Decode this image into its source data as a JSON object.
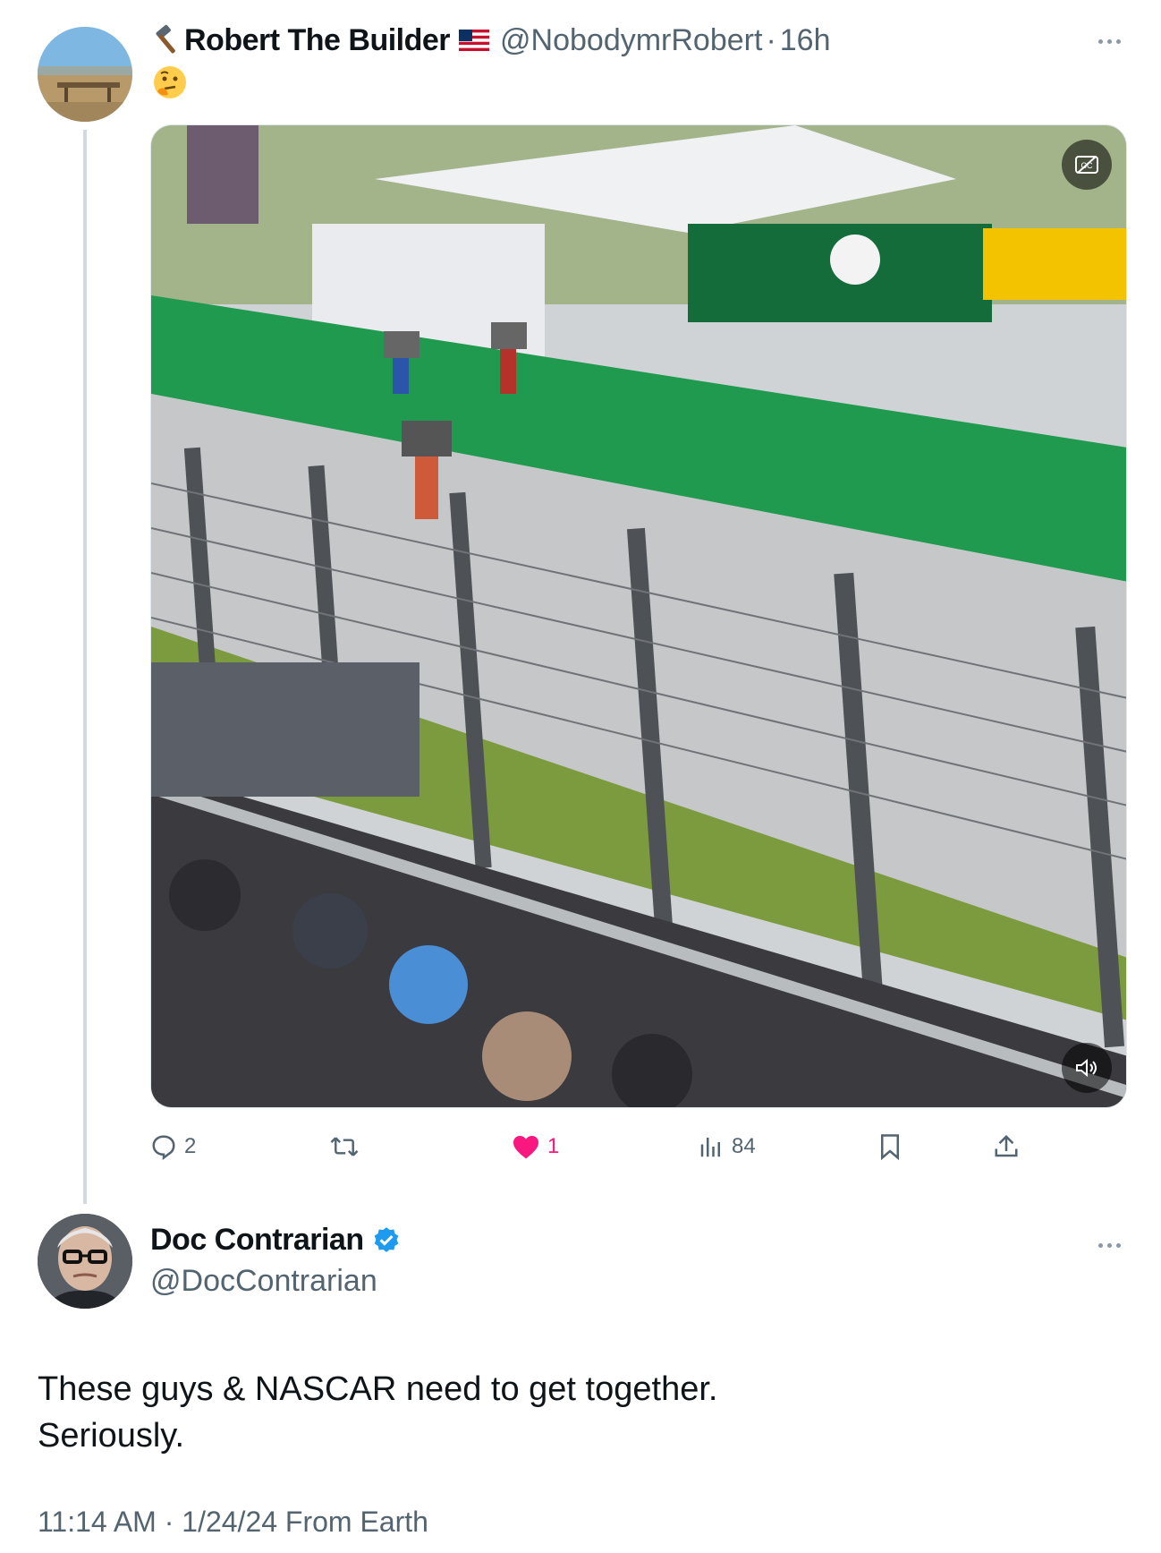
{
  "original_tweet": {
    "name_prefix_icon": "hammer-icon",
    "display_name": "Robert The Builder",
    "flag_icon": "us-flag-icon",
    "handle": "@NobodymrRobert",
    "separator": "·",
    "time_ago": "16h",
    "body_emoji": "thinking-face-emoji",
    "media": {
      "type": "video",
      "cc_icon": "closed-captions-off-icon",
      "mute_icon": "speaker-muted-icon"
    },
    "actions": {
      "replies": "2",
      "retweets": "",
      "likes": "1",
      "views": "84"
    },
    "like_color": "#f91880"
  },
  "reply_tweet": {
    "display_name": "Doc Contrarian",
    "verified_icon": "verified-badge-icon",
    "verified_color": "#1d9bf0",
    "handle": "@DocContrarian",
    "text_lines": [
      "These guys & NASCAR need to get together.",
      "Seriously."
    ],
    "meta": "11:14 AM · 1/24/24 From Earth"
  }
}
